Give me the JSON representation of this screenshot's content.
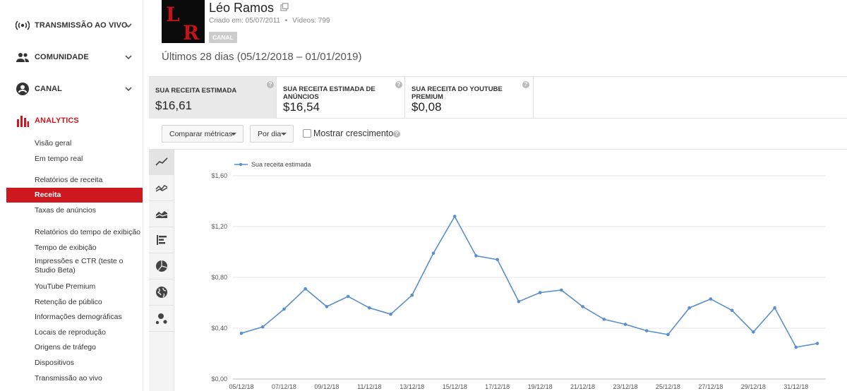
{
  "sidebar": {
    "sections": [
      {
        "label": "TRANSMISSÃO AO VIVO",
        "icon": "live-broadcast-icon"
      },
      {
        "label": "COMUNIDADE",
        "icon": "people-icon"
      },
      {
        "label": "CANAL",
        "icon": "account-circle-icon"
      },
      {
        "label": "ANALYTICS",
        "icon": "bar-chart-icon"
      }
    ],
    "analytics_items": [
      "Visão geral",
      "Em tempo real",
      "Relatórios de receita",
      "Receita",
      "Taxas de anúncios",
      "Relatórios do tempo de exibição",
      "Tempo de exibição",
      "Impressões e CTR (teste o Studio Beta)",
      "YouTube Premium",
      "Retenção de público",
      "Informações demográficas",
      "Locais de reprodução",
      "Origens de tráfego",
      "Dispositivos",
      "Transmissão ao vivo"
    ],
    "active_item": "Receita"
  },
  "channel": {
    "name": "Léo Ramos",
    "avatar_letters": "LR",
    "created": "Criado em: 05/07/2011",
    "videos": "Vídeos: 799",
    "dot": "•",
    "badge": "CANAL"
  },
  "period": "Últimos 28 dias (05/12/2018 – 01/01/2019)",
  "metrics": [
    {
      "label": "SUA RECEITA ESTIMADA",
      "value": "$16,61",
      "selected": true
    },
    {
      "label": "SUA RECEITA ESTIMADA DE ANÚNCIOS",
      "value": "$16,54",
      "selected": false
    },
    {
      "label": "SUA RECEITA DO YOUTUBE PREMIUM",
      "value": "$0,08",
      "selected": false
    }
  ],
  "toolbar": {
    "compare": "Comparar métricas",
    "interval": "Por dia",
    "growth": "Mostrar crescimento",
    "help": "?"
  },
  "chart_types": [
    "line-chart-icon",
    "multi-line-chart-icon",
    "area-chart-icon",
    "bar-chart-horizontal-icon",
    "pie-chart-icon",
    "globe-map-icon",
    "bubble-chart-icon"
  ],
  "colors": {
    "accent": "#cc181e",
    "series": "#5b8fc9",
    "sidebar_active_bg": "#cc181e"
  },
  "chart_data": {
    "type": "line",
    "series": [
      {
        "name": "Sua receita estimada",
        "values": [
          0.36,
          0.41,
          0.55,
          0.71,
          0.57,
          0.65,
          0.56,
          0.51,
          0.66,
          0.99,
          1.28,
          0.97,
          0.94,
          0.61,
          0.68,
          0.7,
          0.57,
          0.47,
          0.43,
          0.38,
          0.35,
          0.56,
          0.63,
          0.54,
          0.37,
          0.56,
          0.25,
          0.28
        ]
      }
    ],
    "x": [
      "05/12/18",
      "06/12/18",
      "07/12/18",
      "08/12/18",
      "09/12/18",
      "10/12/18",
      "11/12/18",
      "12/12/18",
      "13/12/18",
      "14/12/18",
      "15/12/18",
      "16/12/18",
      "17/12/18",
      "18/12/18",
      "19/12/18",
      "20/12/18",
      "21/12/18",
      "22/12/18",
      "23/12/18",
      "24/12/18",
      "25/12/18",
      "26/12/18",
      "27/12/18",
      "28/12/18",
      "29/12/18",
      "30/12/18",
      "31/12/18",
      "01/01/19"
    ],
    "x_tick_labels": [
      "05/12/18",
      "07/12/18",
      "09/12/18",
      "11/12/18",
      "13/12/18",
      "15/12/18",
      "17/12/18",
      "19/12/18",
      "21/12/18",
      "23/12/18",
      "25/12/18",
      "27/12/18",
      "29/12/18",
      "31/12/18"
    ],
    "y_ticks": [
      0,
      0.4,
      0.8,
      1.2,
      1.6
    ],
    "y_tick_labels": [
      "$0,00",
      "$0,40",
      "$0,80",
      "$1,20",
      "$1,60"
    ],
    "ylim": [
      0,
      1.6
    ],
    "grid": true,
    "legend_position": "top-left"
  }
}
